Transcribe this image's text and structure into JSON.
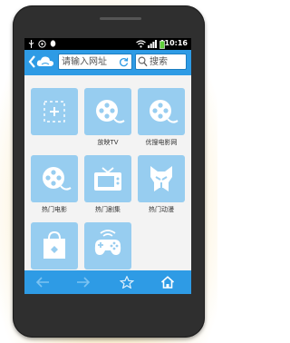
{
  "status_bar": {
    "time": "10:16"
  },
  "toolbar": {
    "url_placeholder": "请输入网址",
    "search_placeholder": "搜索"
  },
  "tiles": [
    {
      "label": "",
      "icon": "add-icon"
    },
    {
      "label": "放映TV",
      "icon": "film-reel-icon"
    },
    {
      "label": "优搜电影网",
      "icon": "film-reel-icon"
    },
    {
      "label": "热门电影",
      "icon": "film-reel-icon"
    },
    {
      "label": "热门剧集",
      "icon": "tv-icon"
    },
    {
      "label": "热门动漫",
      "icon": "transformer-icon"
    },
    {
      "label": "",
      "icon": "shopping-bag-icon"
    },
    {
      "label": "",
      "icon": "gamepad-icon"
    }
  ],
  "colors": {
    "accent": "#2e9be5",
    "tile": "#97cdf0"
  }
}
